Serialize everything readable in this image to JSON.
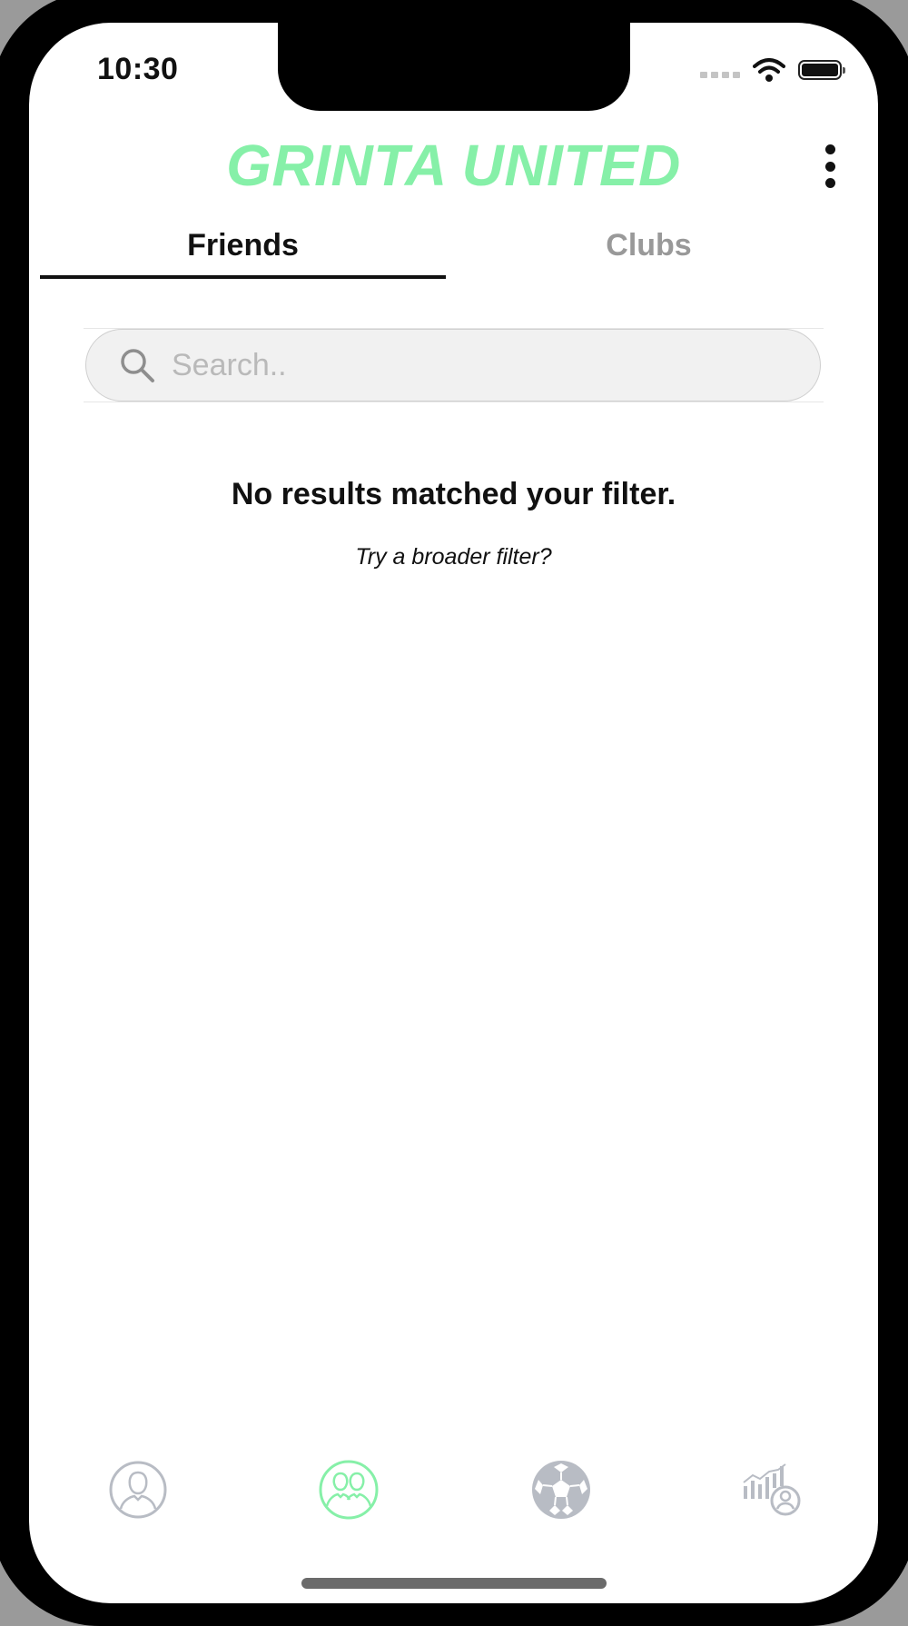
{
  "status_bar": {
    "time": "10:30",
    "icons": [
      "cellular-signal-icon",
      "wifi-icon",
      "battery-icon"
    ]
  },
  "header": {
    "title": "GRINTA UNITED",
    "title_color": "#86f0a8",
    "menu_icon": "more-vertical-icon"
  },
  "tabs": [
    {
      "label": "Friends",
      "active": true
    },
    {
      "label": "Clubs",
      "active": false
    }
  ],
  "search": {
    "placeholder": "Search..",
    "value": "",
    "icon": "search-icon"
  },
  "empty_state": {
    "title": "No results matched your filter.",
    "subtitle": "Try a broader filter?"
  },
  "tab_bar": {
    "active_color": "#86f0a8",
    "inactive_color": "#b8bcc4",
    "items": [
      {
        "icon": "profile-icon",
        "active": false
      },
      {
        "icon": "friends-icon",
        "active": true
      },
      {
        "icon": "soccer-ball-icon",
        "active": false
      },
      {
        "icon": "stats-profile-icon",
        "active": false
      }
    ]
  }
}
